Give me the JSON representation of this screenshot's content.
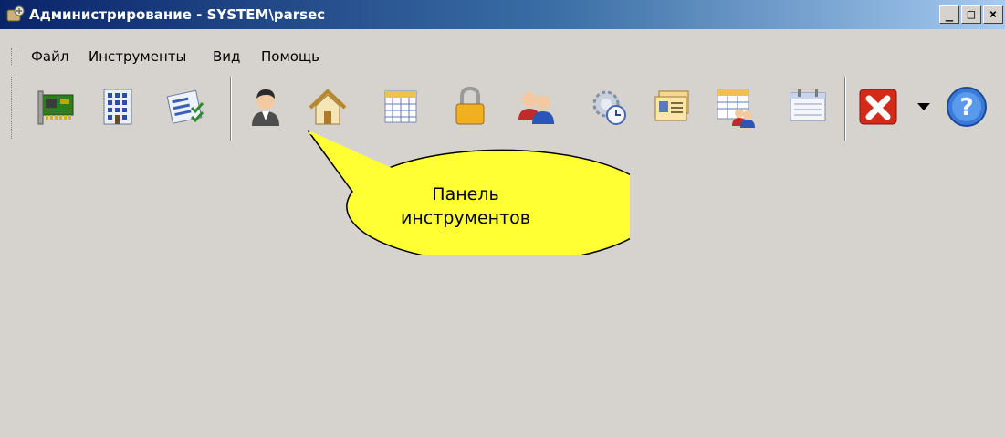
{
  "window": {
    "title": "Администрирование - SYSTEM\\parsec",
    "minimize_glyph": "_",
    "maximize_glyph": "□",
    "close_glyph": "×"
  },
  "menu": {
    "items": [
      "Файл",
      "Инструменты",
      "Вид",
      "Помощь"
    ]
  },
  "toolbar": {
    "buttons": [
      "network-card-icon",
      "building-icon",
      "checklist-icon",
      "person-icon",
      "home-icon",
      "calendar-icon",
      "lock-icon",
      "users-icon",
      "gear-clock-icon",
      "id-cards-icon",
      "calendar-users-icon",
      "schedule-icon",
      "close-red-icon",
      "help-icon"
    ]
  },
  "callout": {
    "line1": "Панель",
    "line2": "инструментов"
  },
  "colors": {
    "background": "#d6d3ce",
    "titlebar_start": "#0a246a",
    "titlebar_end": "#a6caf0",
    "callout_fill": "#ffff33"
  }
}
